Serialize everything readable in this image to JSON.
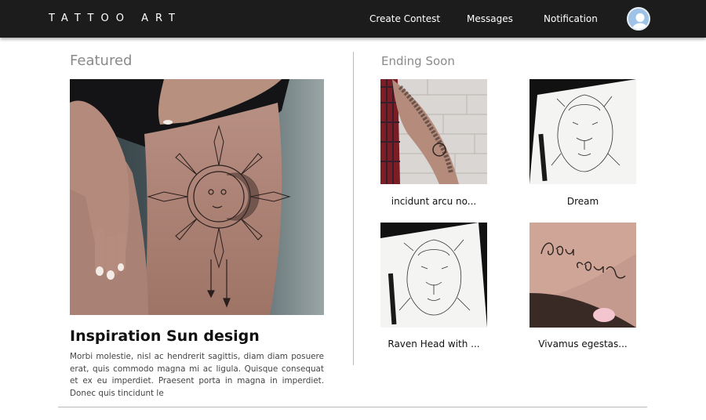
{
  "nav": {
    "brand": "TATTOO ART",
    "links": [
      "Create Contest",
      "Messages",
      "Notification"
    ]
  },
  "featured": {
    "section_title": "Featured",
    "heading": "Inspiration Sun design",
    "description": "Morbi molestie, nisl ac hendrerit sagittis, diam diam posuere erat, quis commodo magna mi ac ligula. Quisque consequat et ex eu imperdiet. Praesent porta in magna in imperdiet. Donec quis tincidunt le"
  },
  "ending_soon": {
    "section_title": "Ending Soon",
    "cards": [
      {
        "label": "incidunt arcu no..."
      },
      {
        "label": "Dream"
      },
      {
        "label": "Raven Head with ..."
      },
      {
        "label": "Vivamus egestas..."
      }
    ]
  },
  "colors": {
    "navbar": "#1c1c1c",
    "section_title": "#8a8a8a",
    "divider": "#b9b9b9"
  }
}
